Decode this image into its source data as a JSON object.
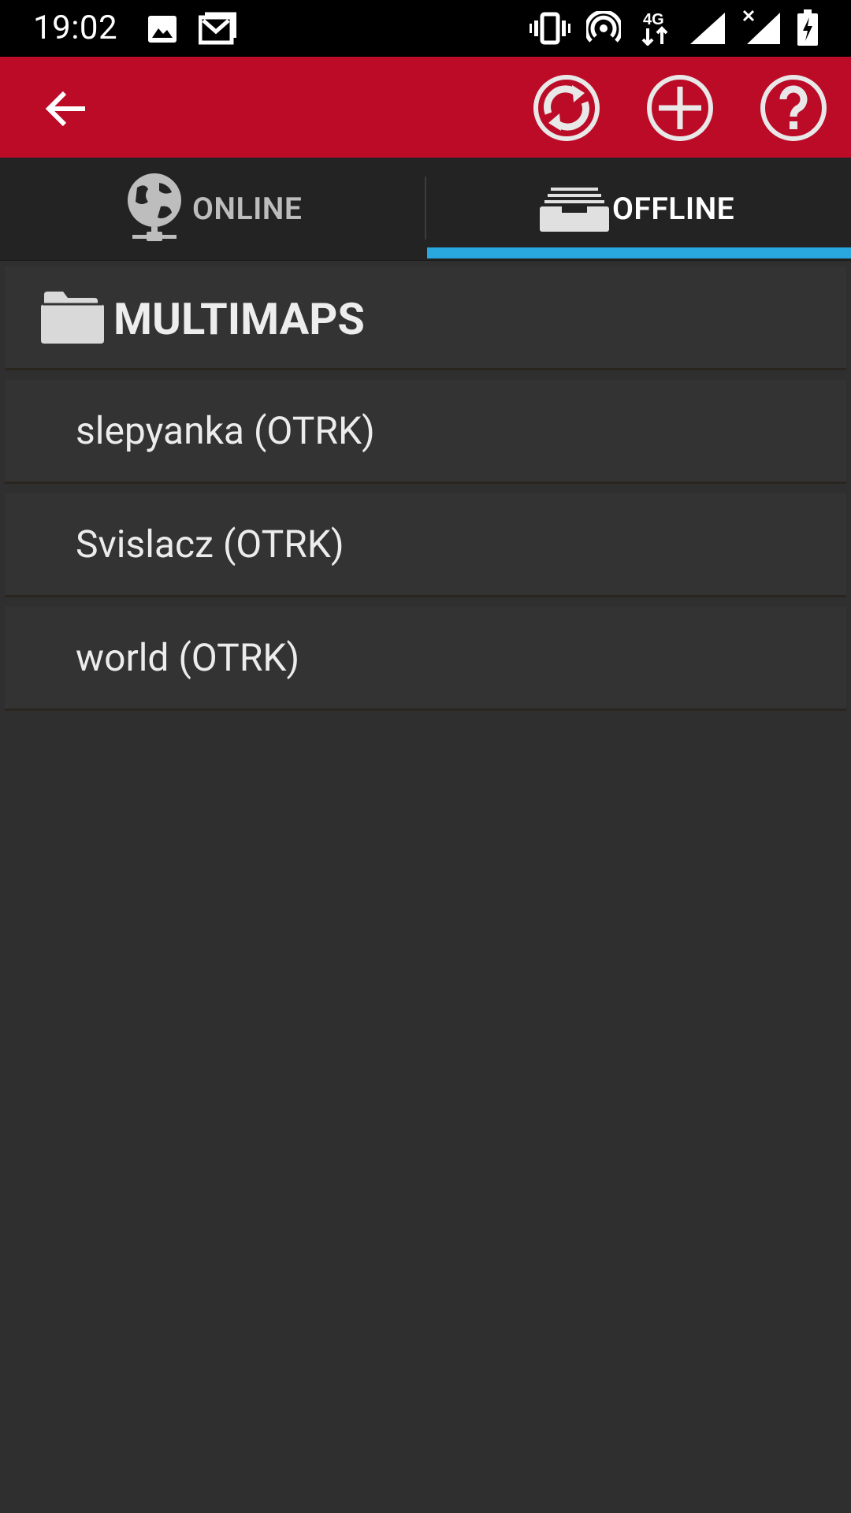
{
  "status_bar": {
    "time": "19:02",
    "left_icons": [
      "image-icon",
      "mail-icon"
    ],
    "right_icons": [
      "vibrate-icon",
      "hotspot-icon",
      "network-4g-icon",
      "signal-icon",
      "signal-no-service-icon",
      "battery-charging-icon"
    ],
    "network_label": "4G"
  },
  "app_bar": {
    "back_icon": "arrow-left-icon",
    "actions": [
      "sync-icon",
      "add-icon",
      "help-icon"
    ]
  },
  "tabs": [
    {
      "label": "ONLINE",
      "icon": "globe-icon",
      "selected": false
    },
    {
      "label": "OFFLINE",
      "icon": "storage-tray-icon",
      "selected": true
    }
  ],
  "accent_color": "#29a7df",
  "appbar_color": "#bc0b27",
  "list": {
    "header": {
      "label": "MULTIMAPS",
      "icon": "folder-icon"
    },
    "items": [
      {
        "label": "slepyanka (OTRK)"
      },
      {
        "label": "Svislacz (OTRK)"
      },
      {
        "label": "world (OTRK)"
      }
    ]
  }
}
